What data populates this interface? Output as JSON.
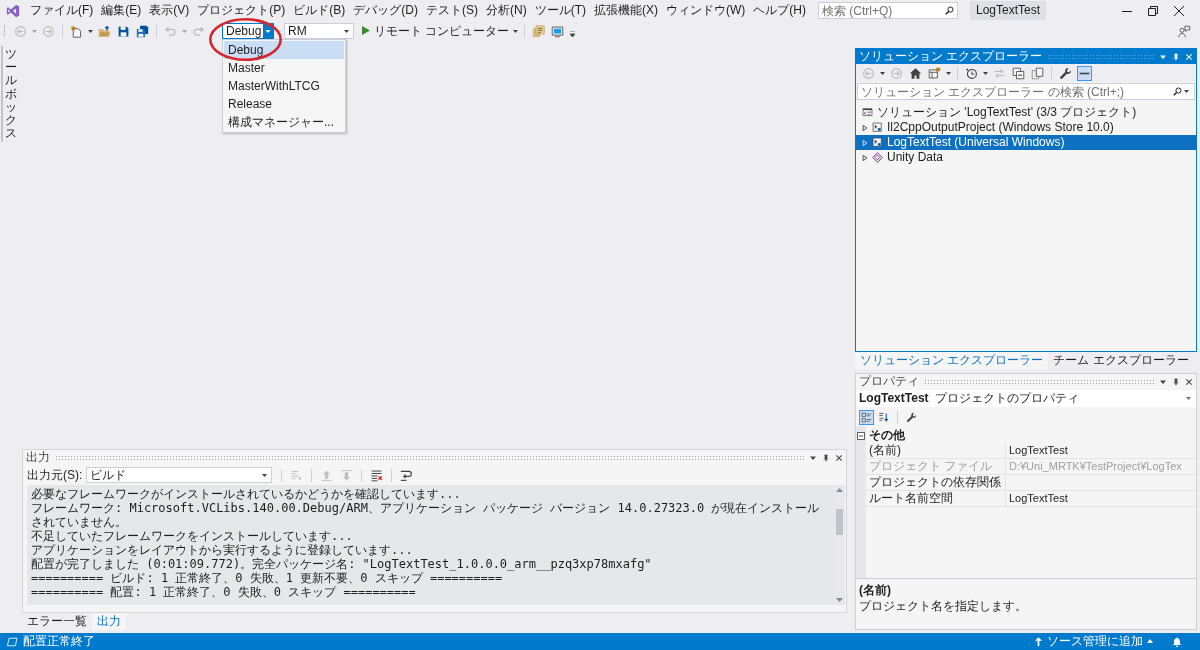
{
  "window": {
    "title": "LogTextTest",
    "search": {
      "placeholder": "検索 (Ctrl+Q)"
    }
  },
  "menu": [
    "ファイル(F)",
    "編集(E)",
    "表示(V)",
    "プロジェクト(P)",
    "ビルド(B)",
    "デバッグ(D)",
    "テスト(S)",
    "分析(N)",
    "ツール(T)",
    "拡張機能(X)",
    "ウィンドウ(W)",
    "ヘルプ(H)"
  ],
  "toolbar": {
    "buttons": [
      {
        "kind": "back",
        "disabled": true
      },
      {
        "kind": "forward",
        "disabled": true
      },
      {
        "kind": "separator"
      },
      {
        "kind": "new",
        "disabled": false
      },
      {
        "kind": "open",
        "disabled": false
      },
      {
        "kind": "save",
        "disabled": false
      },
      {
        "kind": "save_all",
        "disabled": false
      },
      {
        "kind": "separator"
      },
      {
        "kind": "undo",
        "disabled": true
      },
      {
        "kind": "redo",
        "disabled": true
      }
    ],
    "configuration": {
      "value": "Debug",
      "open": true,
      "options": [
        {
          "label": "Debug",
          "selected": true
        },
        {
          "label": "Master",
          "selected": false
        },
        {
          "label": "MasterWithLTCG",
          "selected": false
        },
        {
          "label": "Release",
          "selected": false
        },
        {
          "label": "構成マネージャー...",
          "selected": false
        }
      ]
    },
    "platform": {
      "value": "RM"
    },
    "run": {
      "label": "リモート コンピューター"
    },
    "extra_buttons": [
      {
        "kind": "pages",
        "disabled": false
      },
      {
        "kind": "screen",
        "disabled": false
      }
    ]
  },
  "highlight_circle": true,
  "toolbox": {
    "label": "ツールボックス"
  },
  "output": {
    "title": "出力",
    "active": false,
    "source_label": "出力元(S):",
    "source": "ビルド",
    "buttons": [
      {
        "kind": "separator"
      },
      {
        "kind": "goto",
        "disabled": true
      },
      {
        "kind": "separator"
      },
      {
        "kind": "previous",
        "disabled": true
      },
      {
        "kind": "next",
        "disabled": true
      },
      {
        "kind": "separator"
      },
      {
        "kind": "clear",
        "disabled": false
      },
      {
        "kind": "separator"
      },
      {
        "kind": "wrap",
        "disabled": false
      }
    ],
    "lines": [
      "必要なフレームワークがインストールされているかどうかを確認しています...",
      "フレームワーク: Microsoft.VCLibs.140.00.Debug/ARM、アプリケーション パッケージ バージョン 14.0.27323.0 が現在インストールされていません。",
      "不足していたフレームワークをインストールしています...",
      "アプリケーションをレイアウトから実行するように登録しています...",
      "配置が完了しました (0:01:09.772)。完全パッケージ名: \"LogTextTest_1.0.0.0_arm__pzq3xp78mxafg\"",
      "========== ビルド: 1 正常終了、0 失敗、1 更新不要、0 スキップ ==========",
      "========== 配置: 1 正常終了、0 失敗、0 スキップ =========="
    ]
  },
  "bottom_tabs": [
    {
      "label": "エラー一覧",
      "selected": false
    },
    {
      "label": "出力",
      "selected": true
    }
  ],
  "solution_explorer": {
    "title": "ソリューション エクスプローラー",
    "active": true,
    "buttons": [
      {
        "kind": "back",
        "disabled": true,
        "pressed": false
      },
      {
        "kind": "forward",
        "disabled": true,
        "pressed": false
      },
      {
        "kind": "home",
        "disabled": false,
        "pressed": false
      },
      {
        "kind": "views",
        "disabled": false,
        "pressed": false
      },
      {
        "kind": "separator"
      },
      {
        "kind": "history",
        "disabled": false,
        "pressed": false
      },
      {
        "kind": "sync",
        "disabled": true,
        "pressed": false
      },
      {
        "kind": "collapse",
        "disabled": false,
        "pressed": false
      },
      {
        "kind": "show_all",
        "disabled": false,
        "pressed": false
      },
      {
        "kind": "separator"
      },
      {
        "kind": "properties",
        "disabled": false,
        "pressed": false
      },
      {
        "kind": "preview",
        "disabled": false,
        "pressed": true
      }
    ],
    "search": {
      "placeholder": "ソリューション エクスプローラー の検索 (Ctrl+;)"
    },
    "tree": [
      {
        "label": "ソリューション 'LogTextTest' (3/3 プロジェクト)",
        "kind": "solution",
        "selected": false,
        "children": [
          {
            "label": "Il2CppOutputProject (Windows Store 10.0)",
            "kind": "project",
            "expanded": false,
            "selected": false
          },
          {
            "label": "LogTextTest (Universal Windows)",
            "kind": "project",
            "expanded": false,
            "selected": true
          },
          {
            "label": "Unity Data",
            "kind": "shared",
            "expanded": false,
            "selected": false
          }
        ]
      }
    ]
  },
  "right_tabs": [
    {
      "label": "ソリューション エクスプローラー",
      "selected": true
    },
    {
      "label": "チーム エクスプローラー",
      "selected": false
    }
  ],
  "properties": {
    "title": "プロパティ",
    "active": false,
    "object": {
      "name": "LogTextTest",
      "type": "プロジェクトのプロパティ"
    },
    "view_buttons": [
      {
        "kind": "categorized",
        "selected": true
      },
      {
        "kind": "alphabetical",
        "selected": false
      }
    ],
    "category": {
      "label": "その他",
      "expanded": true,
      "rows": [
        {
          "name": "(名前)",
          "value": "LogTextTest",
          "disabled": false
        },
        {
          "name": "プロジェクト ファイル",
          "value": "D:¥Uni_MRTK¥TestProject¥LogTex",
          "disabled": true
        },
        {
          "name": "プロジェクトの依存関係",
          "disabled": false
        },
        {
          "name": "ルート名前空間",
          "value": "LogTextTest",
          "disabled": false
        }
      ]
    },
    "description": {
      "title": "(名前)",
      "text": "プロジェクト名を指定します。"
    }
  },
  "status_bar": {
    "message": "配置正常終了",
    "source_control": "ソース管理に追加"
  }
}
